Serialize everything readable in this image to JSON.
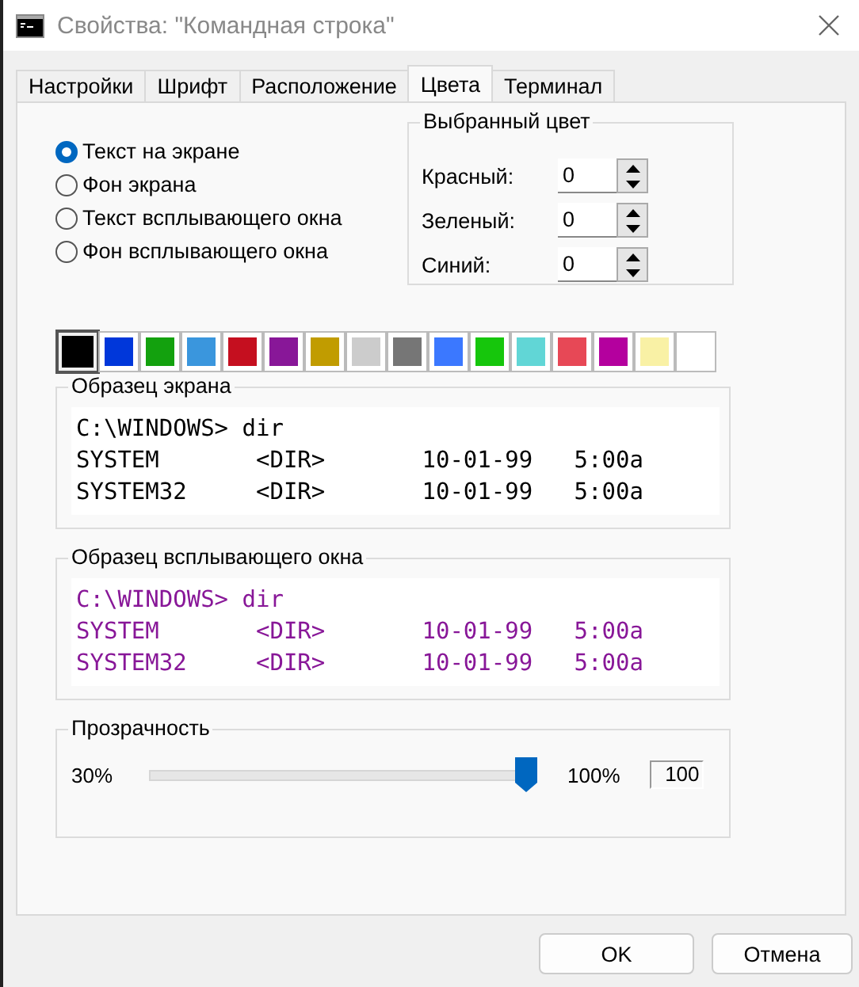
{
  "window": {
    "title": "Свойства: \"Командная строка\""
  },
  "tabs": [
    {
      "label": "Настройки",
      "selected": false
    },
    {
      "label": "Шрифт",
      "selected": false
    },
    {
      "label": "Расположение",
      "selected": false
    },
    {
      "label": "Цвета",
      "selected": true
    },
    {
      "label": "Терминал",
      "selected": false
    }
  ],
  "targets": [
    {
      "label": "Текст на экране",
      "selected": true
    },
    {
      "label": "Фон экрана",
      "selected": false
    },
    {
      "label": "Текст всплывающего окна",
      "selected": false
    },
    {
      "label": "Фон всплывающего окна",
      "selected": false
    }
  ],
  "selected_color": {
    "title": "Выбранный цвет",
    "fields": [
      {
        "label": "Красный:",
        "value": "0"
      },
      {
        "label": "Зеленый:",
        "value": "0"
      },
      {
        "label": "Синий:",
        "value": "0"
      }
    ]
  },
  "palette": [
    {
      "color": "#000000",
      "selected": true
    },
    {
      "color": "#0037da",
      "selected": false
    },
    {
      "color": "#13a10e",
      "selected": false
    },
    {
      "color": "#3a96dd",
      "selected": false
    },
    {
      "color": "#c50f1f",
      "selected": false
    },
    {
      "color": "#881798",
      "selected": false
    },
    {
      "color": "#c19c00",
      "selected": false
    },
    {
      "color": "#cccccc",
      "selected": false
    },
    {
      "color": "#767676",
      "selected": false
    },
    {
      "color": "#3b78ff",
      "selected": false
    },
    {
      "color": "#16c60c",
      "selected": false
    },
    {
      "color": "#61d6d6",
      "selected": false
    },
    {
      "color": "#e74856",
      "selected": false
    },
    {
      "color": "#b4009e",
      "selected": false
    },
    {
      "color": "#f9f1a5",
      "selected": false
    },
    {
      "color": "#ffffff",
      "selected": false
    }
  ],
  "samples": [
    {
      "title": "Образец экрана",
      "color": "#000000",
      "lines": [
        "C:\\WINDOWS> dir",
        "SYSTEM       <DIR>       10-01-99   5:00a",
        "SYSTEM32     <DIR>       10-01-99   5:00a"
      ]
    },
    {
      "title": "Образец всплывающего окна",
      "color": "#881798",
      "lines": [
        "C:\\WINDOWS> dir",
        "SYSTEM       <DIR>       10-01-99   5:00a",
        "SYSTEM32     <DIR>       10-01-99   5:00a"
      ]
    }
  ],
  "opacity": {
    "title": "Прозрачность",
    "min_label": "30%",
    "max_label": "100%",
    "level": 1,
    "value": "100"
  },
  "buttons": [
    "OK",
    "Отмена"
  ]
}
